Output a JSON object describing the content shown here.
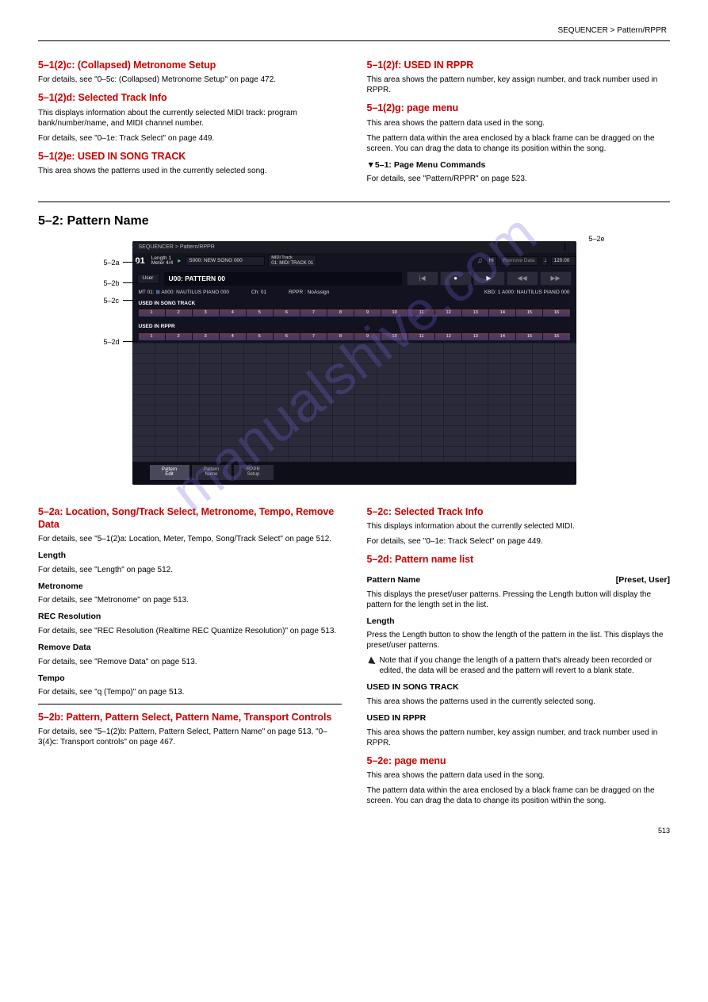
{
  "header_right": "SEQUENCER > Pattern/RPPR",
  "section_a": {
    "h_5_1_5c": "5–1(2)c: (Collapsed) Metronome Setup",
    "p_5_1_5c": "For details, see \"0–5c: (Collapsed) Metronome Setup\" on page 472.",
    "h_5_1_5d": "5–1(2)d: Selected Track Info",
    "p_5_1_5d": "This displays information about the currently selected MIDI track: program bank/number/name, and MIDI channel number.",
    "p_5_1_5d2": "For details, see \"0–1e: Track Select\" on page 449.",
    "h_5_1_5e": "5–1(2)e: USED IN SONG TRACK",
    "p_5_1_5e": "This area shows the patterns used in the currently selected song."
  },
  "section_top_right": {
    "h1": "5–1(2)f: USED IN RPPR",
    "p1": "This area shows the pattern number, key assign number, and track number used in RPPR.",
    "h2": "5–1(2)g: page menu",
    "p2a": "This area shows the pattern data used in the song.",
    "p2b_1": "The pattern data within the area enclosed by a black frame can be dragged on the screen. You can drag the data to change its position within the song.",
    "h3": "▼5–1: Page Menu Commands",
    "p3": "For details, see \"Pattern/RPPR\" on page 523."
  },
  "section_5_2": {
    "title": "5–2: Pattern Name",
    "annot_left1": "5–2a",
    "annot_left2": "5–2b",
    "annot_left3": "5–2c",
    "annot_left4": "5–2d",
    "annot_right": "5–2e",
    "h_5_2a": "5–2a: Location, Song/Track Select, Metronome, Tempo, Remove Data",
    "p_5_2a": "For details, see \"5–1(2)a: Location, Meter, Tempo, Song/Track Select\" on page 512.",
    "sub1": "Length",
    "sub1_p": "For details, see \"Length\" on page 512.",
    "sub2": "Metronome",
    "sub2_p": "For details, see \"Metronome\" on page 513.",
    "sub3": "REC Resolution",
    "sub3_p": "For details, see \"REC Resolution (Realtime REC Quantize Resolution)\" on page 513.",
    "sub4": "Remove Data",
    "sub4_p": "For details, see \"Remove Data\" on page 513.",
    "sub5": "Tempo",
    "sub5_p": "For details, see \"q (Tempo)\" on page 513.",
    "h_5_2b": "5–2b: Pattern, Pattern Select, Pattern Name, Transport Controls",
    "p_5_2b": "For details, see \"5–1(2)b: Pattern, Pattern Select, Pattern Name\" on page 513, \"0–3(4)c: Transport controls\" on page 467.",
    "right_h1": "5–2c: Selected Track Info",
    "right_p1": "This displays information about the currently selected MIDI.",
    "right_p1b": "For details, see \"0–1e: Track Select\" on page 449.",
    "right_h2": "5–2d: Pattern name list",
    "right_sub1": "Pattern Name",
    "right_sub1_r": "[Preset, User]",
    "right_sub1_p": "This displays the preset/user patterns. Pressing the Length button will display the pattern for the length set in the list.",
    "right_sub2": "Length",
    "right_sub2_p": "Press the Length button to show the length of the pattern in the list. This displays the preset/user patterns.",
    "warn_p": "Note that if you change the length of a pattern that's already been recorded or edited, the data will be erased and the pattern will revert to a blank state.",
    "right_sub3": "USED IN SONG TRACK",
    "right_sub3_p": "This area shows the patterns used in the currently selected song.",
    "right_sub4": "USED IN RPPR",
    "right_sub4_p": "This area shows the pattern number, key assign number, and track number used in RPPR.",
    "right_h3": "5–2e: page menu",
    "right_p3a": "This area shows the pattern data used in the song.",
    "right_p3b": "The pattern data within the area enclosed by a black frame can be dragged on the screen. You can drag the data to change its position within the song."
  },
  "screenshot": {
    "titlebar": "SEQUENCER > Pattern/RPPR",
    "loc": "01",
    "length": "Length 1",
    "meter": "Meter 4/4",
    "song": "S000: NEW SONG 000",
    "midi_label": "MIDI Track",
    "midi_value": "01: MIDI TRACK 01",
    "hi": "Hi",
    "remove": "Remove Data",
    "tempo": "120.00",
    "user": "User",
    "pattern_name": "U00: PATTERN 00",
    "info_mt": "MT 01:",
    "info_prog": "A000: NAUTILUS PIANO 000",
    "info_ch": "Ch: 01",
    "info_rppr": "RPPR : NoAssign",
    "info_kbd": "KBD: 1   A000: NAUTILUS PIANO 000",
    "sec1": "USED IN SONG TRACK",
    "sec2": "USED IN RPPR",
    "tracks": [
      "1",
      "2",
      "3",
      "4",
      "5",
      "6",
      "7",
      "8",
      "9",
      "10",
      "11",
      "12",
      "13",
      "14",
      "15",
      "16"
    ],
    "tab1a": "Pattern",
    "tab1b": "Edit",
    "tab2a": "Pattern",
    "tab2b": "Name",
    "tab3a": "RPPR",
    "tab3b": "Setup"
  },
  "footer": "513"
}
